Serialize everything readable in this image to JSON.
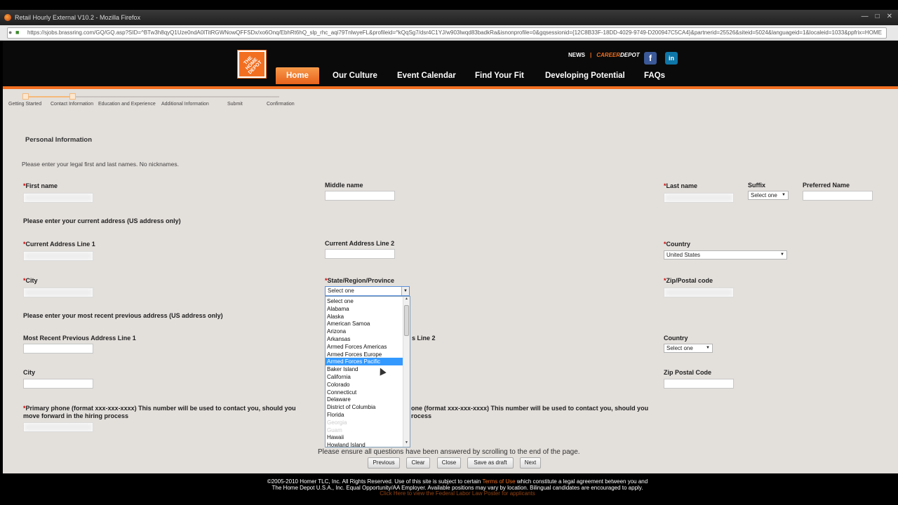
{
  "browser": {
    "window_title": "Retail Hourly External V10.2 - Mozilla Firefox",
    "url": "https://sjobs.brassring.com/GQ/GQ.asp?SID=^BTw3h8qyQ1Uze0ndA0lTitRGWNowQFFSDx/xo6Onq/EbhRt6hQ_slp_rhc_aqi79TnlwyeFL&profileid=^kQqSg7/dsr4C1YJ/w903lwqd83badkRa&isnonprofile=0&gqsessionid={12C8B33F-18DD-4029-9749-D200947C5CA4}&partnerid=25526&siteid=5024&languageid=1&localeid=1033&ppfrix=HOME"
  },
  "header": {
    "logo_text": "THE HOME DEPOT",
    "news": "NEWS",
    "careers_a": "CAREER",
    "careers_b": "DEPOT",
    "nav": [
      "Home",
      "Our Culture",
      "Event Calendar",
      "Find Your Fit",
      "Developing Potential",
      "FAQs"
    ],
    "facebook": "f",
    "linkedin": "in"
  },
  "steps": [
    "Getting Started",
    "Contact Information",
    "Education and Experience",
    "Additional Information",
    "Submit",
    "Confirmation"
  ],
  "form": {
    "section_title": "Personal Information",
    "instruction_names": "Please enter your legal first and last names. No nicknames.",
    "first_name": "First name",
    "middle_name": "Middle name",
    "last_name": "Last name",
    "suffix": "Suffix",
    "suffix_value": "Select one",
    "preferred_name": "Preferred Name",
    "instruction_address": "Please enter your current address (US address only)",
    "addr1": "Current Address Line 1",
    "addr2": "Current Address Line 2",
    "country": "Country",
    "country_value": "United States",
    "city": "City",
    "state": "State/Region/Province",
    "state_value": "Select one",
    "zip": "Zip/Postal code",
    "instruction_prev": "Please enter your most recent previous address (US address only)",
    "prev_addr1": "Most Recent Previous Address Line 1",
    "prev_addr2_tail": "s Line 2",
    "prev_country": "Country",
    "prev_country_value": "Select one",
    "prev_city": "City",
    "prev_zip": "Zip Postal Code",
    "primary_phone": "Primary phone (format xxx-xxx-xxxx) This number will be used to contact you, should you move forward in the hiring process",
    "secondary_phone_tail_1": "one (format xxx-xxx-xxxx) This number will be used to contact you, should you",
    "secondary_phone_tail_2": "rocess",
    "notice": "Please ensure all questions have been answered by scrolling to the end of the page."
  },
  "state_options": [
    "Select one",
    "Alabama",
    "Alaska",
    "American Samoa",
    "Arizona",
    "Arkansas",
    "Armed Forces Americas",
    "Armed Forces Europe",
    "Armed Forces Pacific",
    "Baker Island",
    "California",
    "Colorado",
    "Connecticut",
    "Delaware",
    "District of Columbia",
    "Florida",
    "Georgia",
    "Guam",
    "Hawaii",
    "Howland Island"
  ],
  "selected_state_option": "Armed Forces Pacific",
  "buttons": {
    "previous": "Previous",
    "clear": "Clear",
    "close": "Close",
    "save_draft": "Save as draft",
    "next": "Next"
  },
  "footer": {
    "line1_a": "©2005-2010 Homer TLC, Inc. All Rights Reserved. Use of this site is subject to certain ",
    "terms": "Terms of Use",
    "line1_b": " which constitute a legal agreement between you and",
    "line2": "The Home Depot U.S.A., Inc. Equal Opportunity/AA Employer. Available positions may vary by location. Bilingual candidates are encouraged to apply.",
    "line3": "Click Here to view the Federal Labor Law Poster for applicants"
  },
  "colors": {
    "brand_orange": "#f26f21",
    "header_bg": "#0a0a0a",
    "page_bg": "#e3dfdb",
    "selection_blue": "#3399ff"
  }
}
